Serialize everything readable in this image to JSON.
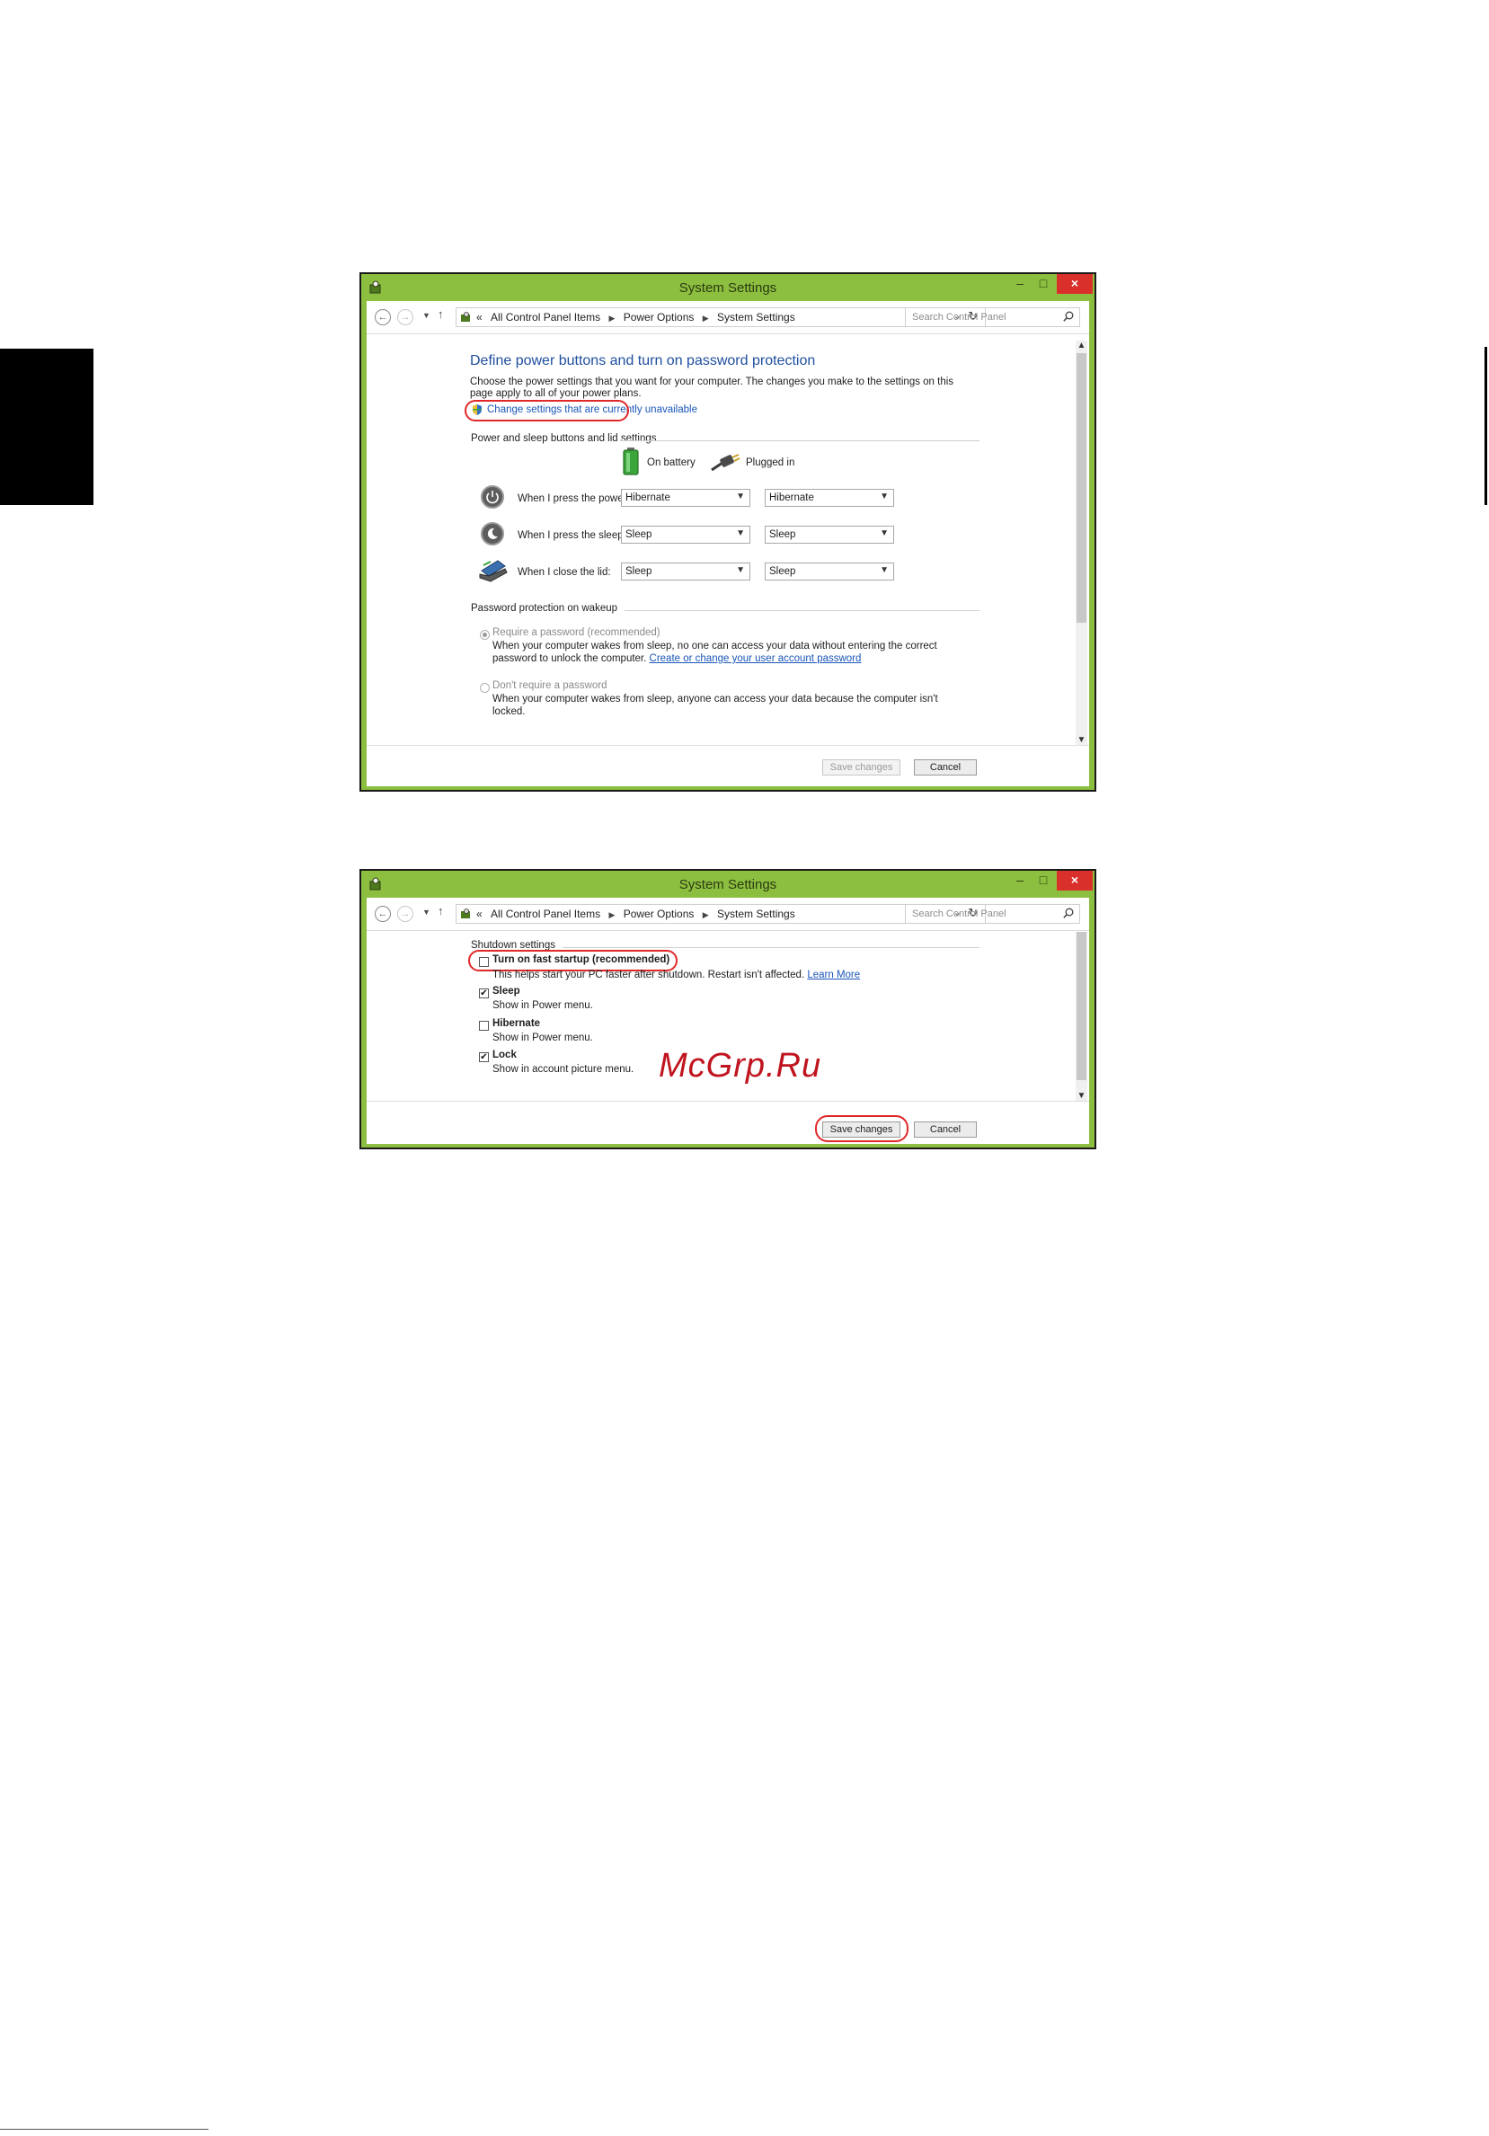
{
  "window1": {
    "title": "System Settings",
    "controls": {
      "minimize": "–",
      "maximize": "□",
      "close": "×"
    },
    "breadcrumb": {
      "prefix": "«",
      "items": [
        "All Control Panel Items",
        "Power Options",
        "System Settings"
      ]
    },
    "search_placeholder": "Search Control Panel",
    "heading": "Define power buttons and turn on password protection",
    "intro_line1": "Choose the power settings that you want for your computer. The changes you make to the settings on this",
    "intro_line2": "page apply to all of your power plans.",
    "change_link": "Change settings that are currently unavailable",
    "section_buttons": "Power and sleep buttons and lid settings",
    "col_battery": "On battery",
    "col_plugged": "Plugged in",
    "rows": [
      {
        "label": "When I press the power button:",
        "battery": "Hibernate",
        "plugged": "Hibernate"
      },
      {
        "label": "When I press the sleep button:",
        "battery": "Sleep",
        "plugged": "Sleep"
      },
      {
        "label": "When I close the lid:",
        "battery": "Sleep",
        "plugged": "Sleep"
      }
    ],
    "section_password": "Password protection on wakeup",
    "require_label": "Require a password (recommended)",
    "require_desc1": "When your computer wakes from sleep, no one can access your data without entering the correct",
    "require_desc2_pre": "password to unlock the computer.",
    "require_desc2_link": "Create or change your user account password",
    "norequire_label": "Don't require a password",
    "norequire_desc1": "When your computer wakes from sleep, anyone can access your data because the computer isn't",
    "norequire_desc2": "locked.",
    "save_button": "Save changes",
    "cancel_button": "Cancel"
  },
  "window2": {
    "title": "System Settings",
    "controls": {
      "minimize": "–",
      "maximize": "□",
      "close": "×"
    },
    "breadcrumb": {
      "prefix": "«",
      "items": [
        "All Control Panel Items",
        "Power Options",
        "System Settings"
      ]
    },
    "search_placeholder": "Search Control Panel",
    "section_shutdown": "Shutdown settings",
    "options": [
      {
        "label": "Turn on fast startup (recommended)",
        "checked": false,
        "desc": "This helps start your PC faster after shutdown. Restart isn't affected.",
        "link": "Learn More"
      },
      {
        "label": "Sleep",
        "checked": true,
        "desc": "Show in Power menu."
      },
      {
        "label": "Hibernate",
        "checked": false,
        "desc": "Show in Power menu."
      },
      {
        "label": "Lock",
        "checked": true,
        "desc": "Show in account picture menu."
      }
    ],
    "save_button": "Save changes",
    "cancel_button": "Cancel"
  },
  "watermark": "McGrp.Ru",
  "bottom_fragment": "          "
}
